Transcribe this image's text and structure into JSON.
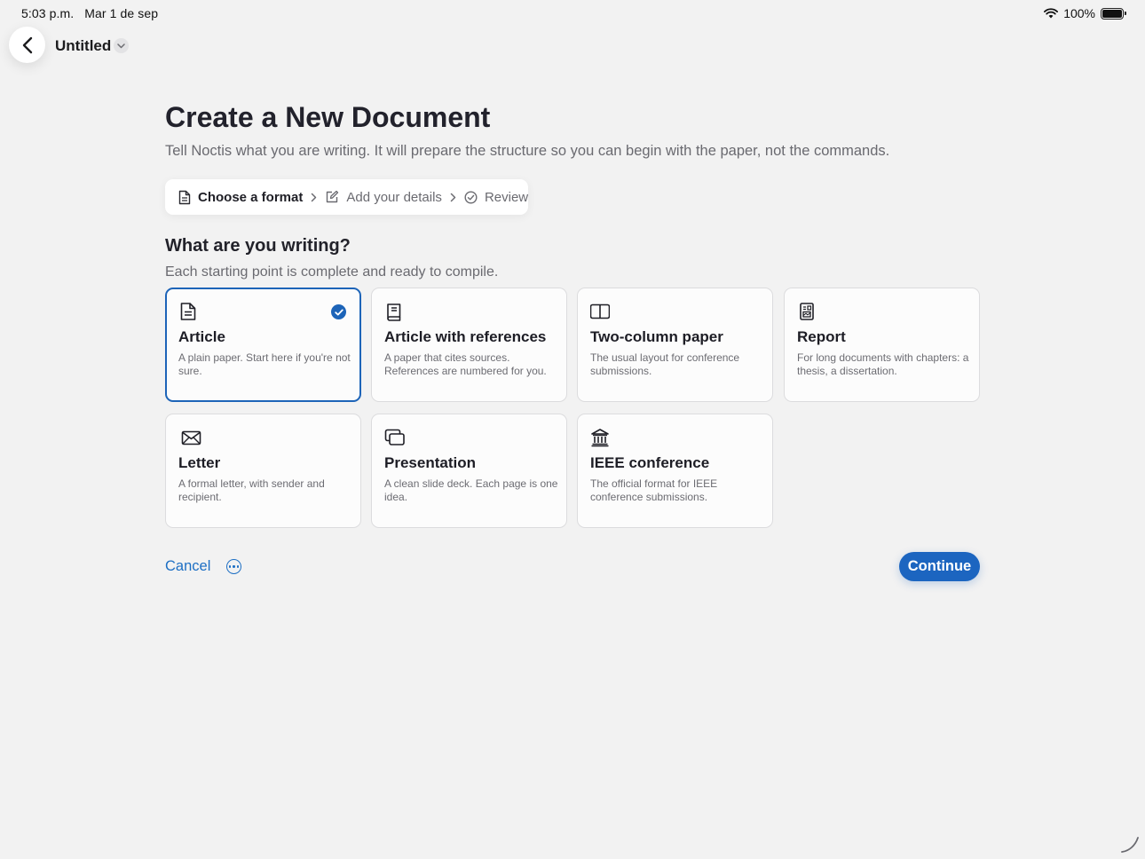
{
  "status_bar": {
    "time": "5:03 p.m.",
    "date": "Mar 1 de sep",
    "battery_text": "100%",
    "battery_level": 1.0
  },
  "header": {
    "document_title": "Untitled",
    "icons": {
      "back": "chevron-left-icon",
      "title_menu": "chevron-down-icon"
    }
  },
  "page": {
    "title": "Create a New Document",
    "subtitle": "Tell Noctis what you are writing. It will prepare the structure so you can begin with the paper, not the commands."
  },
  "stepper": {
    "steps": [
      {
        "label": "Choose a format",
        "icon": "document-icon",
        "active": true
      },
      {
        "label": "Add your details",
        "icon": "edit-icon",
        "active": false
      },
      {
        "label": "Review",
        "icon": "check-circle-icon",
        "active": false
      }
    ]
  },
  "section": {
    "heading": "What are you writing?",
    "subheading": "Each starting point is complete and ready to compile."
  },
  "formats": [
    {
      "title": "Article",
      "description": "A plain paper. Start here if you're not sure.",
      "icon": "document-icon",
      "selected": true
    },
    {
      "title": "Article with references",
      "description": "A paper that cites sources. References are numbered for you.",
      "icon": "book-icon",
      "selected": false
    },
    {
      "title": "Two-column paper",
      "description": "The usual layout for conference submissions.",
      "icon": "columns-icon",
      "selected": false
    },
    {
      "title": "Report",
      "description": "For long documents with chapters: a thesis, a dissertation.",
      "icon": "report-icon",
      "selected": false
    },
    {
      "title": "Letter",
      "description": "A formal letter, with sender and recipient.",
      "icon": "envelope-icon",
      "selected": false
    },
    {
      "title": "Presentation",
      "description": "A clean slide deck. Each page is one idea.",
      "icon": "slides-icon",
      "selected": false
    },
    {
      "title": "IEEE conference",
      "description": "The official format for IEEE conference submissions.",
      "icon": "institution-icon",
      "selected": false
    }
  ],
  "actions": {
    "cancel_label": "Cancel",
    "continue_label": "Continue"
  },
  "colors": {
    "accent": "#1c65c0",
    "background": "#f2f2f2",
    "card_background": "#fcfcfc"
  }
}
